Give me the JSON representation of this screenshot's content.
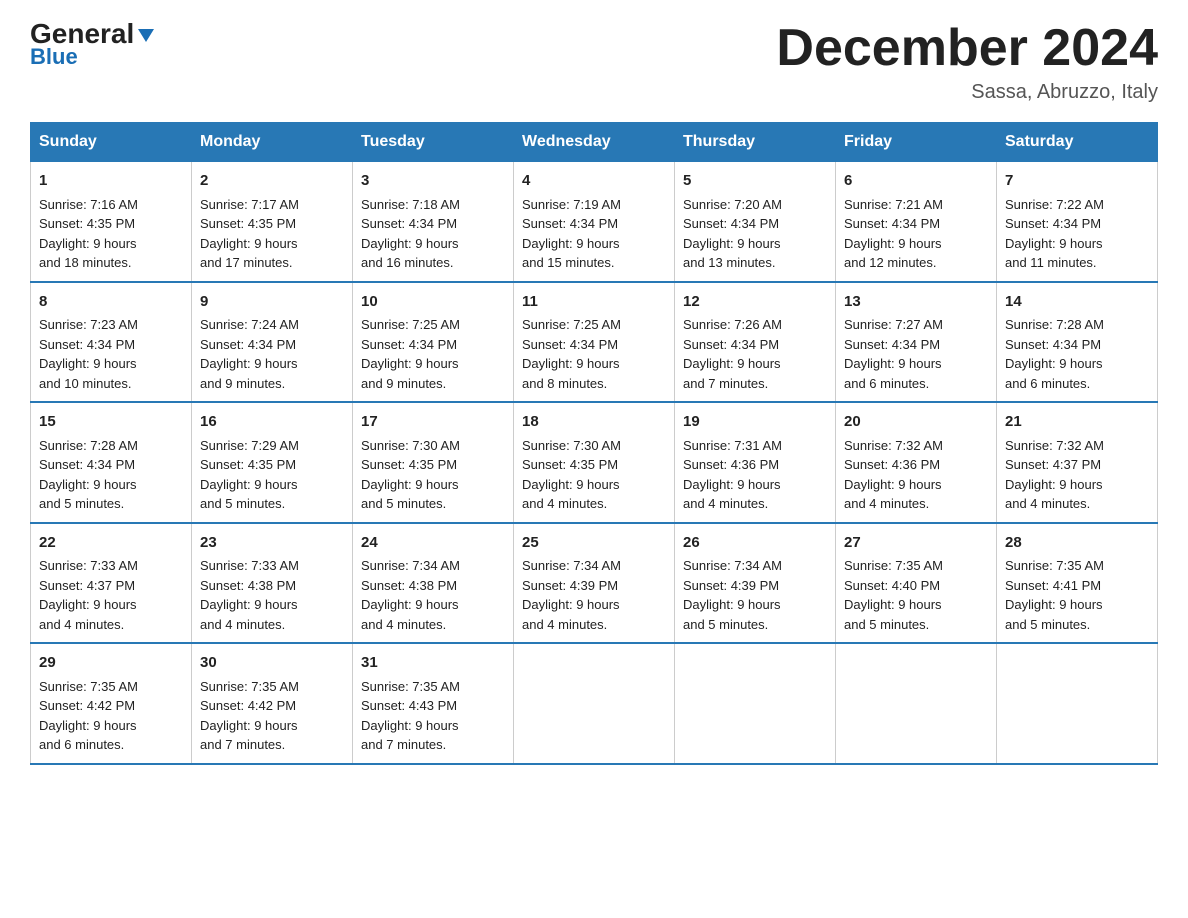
{
  "logo": {
    "general": "General",
    "blue": "Blue"
  },
  "title": "December 2024",
  "location": "Sassa, Abruzzo, Italy",
  "days_of_week": [
    "Sunday",
    "Monday",
    "Tuesday",
    "Wednesday",
    "Thursday",
    "Friday",
    "Saturday"
  ],
  "weeks": [
    [
      {
        "day": "1",
        "sunrise": "7:16 AM",
        "sunset": "4:35 PM",
        "daylight": "9 hours and 18 minutes."
      },
      {
        "day": "2",
        "sunrise": "7:17 AM",
        "sunset": "4:35 PM",
        "daylight": "9 hours and 17 minutes."
      },
      {
        "day": "3",
        "sunrise": "7:18 AM",
        "sunset": "4:34 PM",
        "daylight": "9 hours and 16 minutes."
      },
      {
        "day": "4",
        "sunrise": "7:19 AM",
        "sunset": "4:34 PM",
        "daylight": "9 hours and 15 minutes."
      },
      {
        "day": "5",
        "sunrise": "7:20 AM",
        "sunset": "4:34 PM",
        "daylight": "9 hours and 13 minutes."
      },
      {
        "day": "6",
        "sunrise": "7:21 AM",
        "sunset": "4:34 PM",
        "daylight": "9 hours and 12 minutes."
      },
      {
        "day": "7",
        "sunrise": "7:22 AM",
        "sunset": "4:34 PM",
        "daylight": "9 hours and 11 minutes."
      }
    ],
    [
      {
        "day": "8",
        "sunrise": "7:23 AM",
        "sunset": "4:34 PM",
        "daylight": "9 hours and 10 minutes."
      },
      {
        "day": "9",
        "sunrise": "7:24 AM",
        "sunset": "4:34 PM",
        "daylight": "9 hours and 9 minutes."
      },
      {
        "day": "10",
        "sunrise": "7:25 AM",
        "sunset": "4:34 PM",
        "daylight": "9 hours and 9 minutes."
      },
      {
        "day": "11",
        "sunrise": "7:25 AM",
        "sunset": "4:34 PM",
        "daylight": "9 hours and 8 minutes."
      },
      {
        "day": "12",
        "sunrise": "7:26 AM",
        "sunset": "4:34 PM",
        "daylight": "9 hours and 7 minutes."
      },
      {
        "day": "13",
        "sunrise": "7:27 AM",
        "sunset": "4:34 PM",
        "daylight": "9 hours and 6 minutes."
      },
      {
        "day": "14",
        "sunrise": "7:28 AM",
        "sunset": "4:34 PM",
        "daylight": "9 hours and 6 minutes."
      }
    ],
    [
      {
        "day": "15",
        "sunrise": "7:28 AM",
        "sunset": "4:34 PM",
        "daylight": "9 hours and 5 minutes."
      },
      {
        "day": "16",
        "sunrise": "7:29 AM",
        "sunset": "4:35 PM",
        "daylight": "9 hours and 5 minutes."
      },
      {
        "day": "17",
        "sunrise": "7:30 AM",
        "sunset": "4:35 PM",
        "daylight": "9 hours and 5 minutes."
      },
      {
        "day": "18",
        "sunrise": "7:30 AM",
        "sunset": "4:35 PM",
        "daylight": "9 hours and 4 minutes."
      },
      {
        "day": "19",
        "sunrise": "7:31 AM",
        "sunset": "4:36 PM",
        "daylight": "9 hours and 4 minutes."
      },
      {
        "day": "20",
        "sunrise": "7:32 AM",
        "sunset": "4:36 PM",
        "daylight": "9 hours and 4 minutes."
      },
      {
        "day": "21",
        "sunrise": "7:32 AM",
        "sunset": "4:37 PM",
        "daylight": "9 hours and 4 minutes."
      }
    ],
    [
      {
        "day": "22",
        "sunrise": "7:33 AM",
        "sunset": "4:37 PM",
        "daylight": "9 hours and 4 minutes."
      },
      {
        "day": "23",
        "sunrise": "7:33 AM",
        "sunset": "4:38 PM",
        "daylight": "9 hours and 4 minutes."
      },
      {
        "day": "24",
        "sunrise": "7:34 AM",
        "sunset": "4:38 PM",
        "daylight": "9 hours and 4 minutes."
      },
      {
        "day": "25",
        "sunrise": "7:34 AM",
        "sunset": "4:39 PM",
        "daylight": "9 hours and 4 minutes."
      },
      {
        "day": "26",
        "sunrise": "7:34 AM",
        "sunset": "4:39 PM",
        "daylight": "9 hours and 5 minutes."
      },
      {
        "day": "27",
        "sunrise": "7:35 AM",
        "sunset": "4:40 PM",
        "daylight": "9 hours and 5 minutes."
      },
      {
        "day": "28",
        "sunrise": "7:35 AM",
        "sunset": "4:41 PM",
        "daylight": "9 hours and 5 minutes."
      }
    ],
    [
      {
        "day": "29",
        "sunrise": "7:35 AM",
        "sunset": "4:42 PM",
        "daylight": "9 hours and 6 minutes."
      },
      {
        "day": "30",
        "sunrise": "7:35 AM",
        "sunset": "4:42 PM",
        "daylight": "9 hours and 7 minutes."
      },
      {
        "day": "31",
        "sunrise": "7:35 AM",
        "sunset": "4:43 PM",
        "daylight": "9 hours and 7 minutes."
      },
      null,
      null,
      null,
      null
    ]
  ],
  "labels": {
    "sunrise": "Sunrise:",
    "sunset": "Sunset:",
    "daylight": "Daylight:"
  }
}
